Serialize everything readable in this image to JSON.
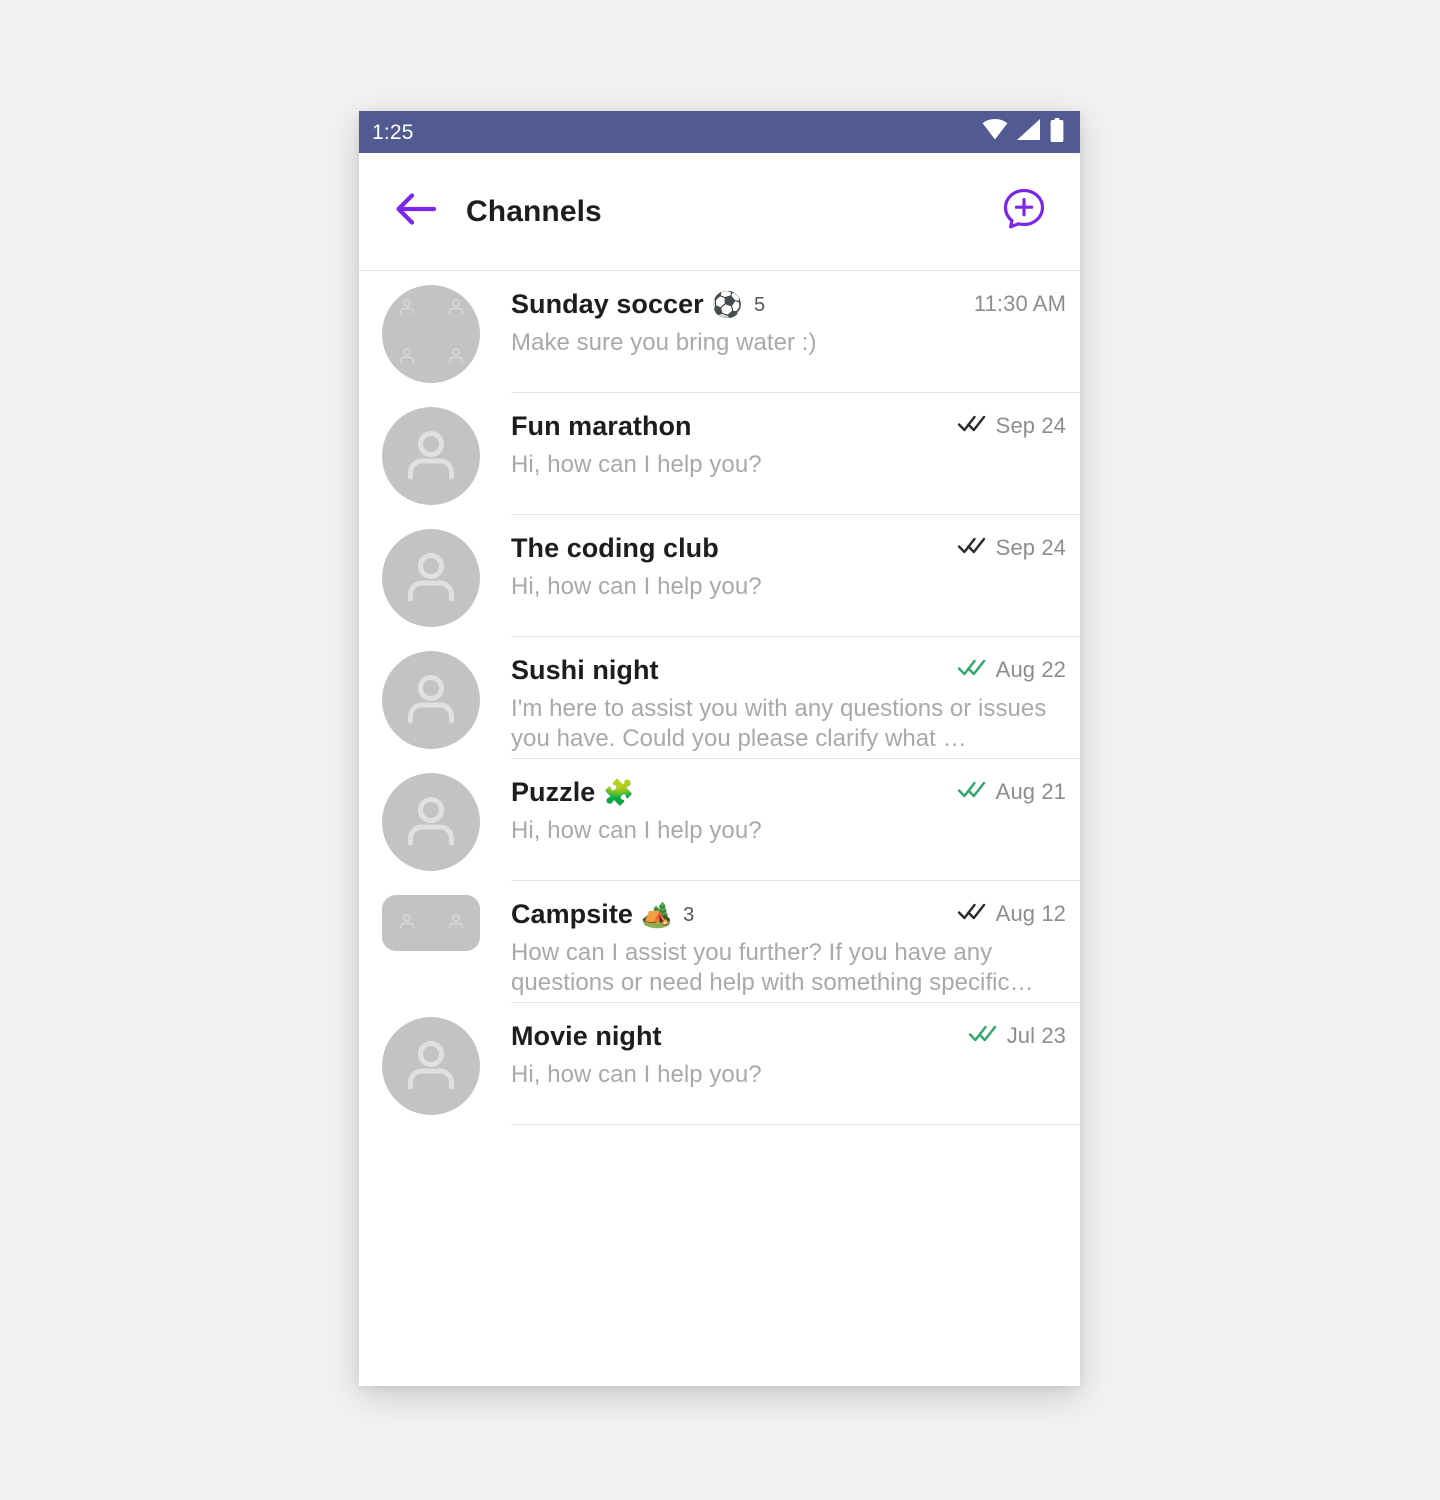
{
  "statusbar": {
    "time": "1:25",
    "icons": [
      "wifi-icon",
      "cell-signal-icon",
      "battery-icon"
    ],
    "background": "#525a92",
    "foreground": "#ffffff"
  },
  "appbar": {
    "back_icon": "arrow-left-icon",
    "title": "Channels",
    "action_icon": "new-chat-icon",
    "accent": "#7b27ea"
  },
  "colors": {
    "accent": "#7b27ea",
    "title_text": "#1d1d1d",
    "preview_text": "#a9a9a9",
    "time_text": "#8d8d8d",
    "tick_read": "#2fa86a",
    "tick_delivered": "#2b2b2b",
    "avatar_bg": "#c3c3c3",
    "divider": "#e4e4e4",
    "page_bg": "#f2f2f2"
  },
  "list": {
    "items": [
      {
        "title": "Sunday soccer",
        "emoji": "⚽",
        "emoji_name": "soccer-ball-emoji",
        "member_count": "5",
        "preview": "Make sure you bring water :)",
        "time": "11:30 AM",
        "ticks": "none",
        "avatar": "group-avatar"
      },
      {
        "title": "Fun marathon",
        "emoji": "",
        "emoji_name": "",
        "member_count": "",
        "preview": "Hi, how can I help you?",
        "time": "Sep 24",
        "ticks": "delivered",
        "avatar": "person-avatar"
      },
      {
        "title": "The coding club",
        "emoji": "",
        "emoji_name": "",
        "member_count": "",
        "preview": "Hi, how can I help you?",
        "time": "Sep 24",
        "ticks": "delivered",
        "avatar": "person-avatar"
      },
      {
        "title": "Sushi night",
        "emoji": "",
        "emoji_name": "",
        "member_count": "",
        "preview": "I'm here to assist you with any questions or issues you have. Could you please clarify what …",
        "time": "Aug 22",
        "ticks": "read",
        "avatar": "person-avatar"
      },
      {
        "title": "Puzzle",
        "emoji": "🧩",
        "emoji_name": "puzzle-piece-emoji",
        "member_count": "",
        "preview": "Hi, how can I help you?",
        "time": "Aug 21",
        "ticks": "read",
        "avatar": "person-avatar"
      },
      {
        "title": "Campsite",
        "emoji": "🏕️",
        "emoji_name": "camping-emoji",
        "member_count": "3",
        "preview": "How can I assist you further? If you have any questions or need help with something specific…",
        "time": "Aug 12",
        "ticks": "delivered",
        "avatar": "group-avatar-clipped"
      },
      {
        "title": "Movie night",
        "emoji": "",
        "emoji_name": "",
        "member_count": "",
        "preview": "Hi, how can I help you?",
        "time": "Jul 23",
        "ticks": "read",
        "avatar": "person-avatar"
      }
    ]
  }
}
